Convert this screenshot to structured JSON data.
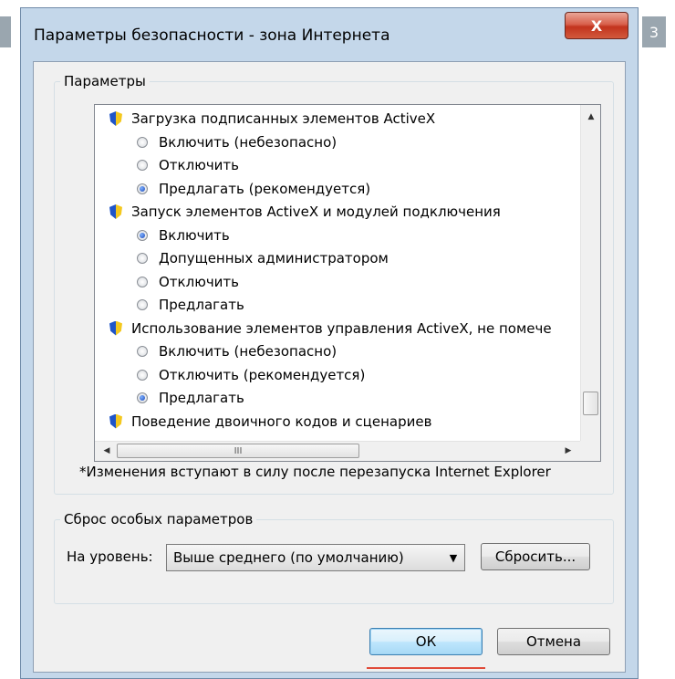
{
  "side_badges": {
    "left": "",
    "right": "3"
  },
  "dialog": {
    "title": "Параметры безопасности - зона Интернета",
    "close_label": "X"
  },
  "params": {
    "legend": "Параметры",
    "items": [
      {
        "kind": "header",
        "label": "Загрузка подписанных элементов ActiveX",
        "icon": "shield-icon"
      },
      {
        "kind": "option",
        "label": "Включить (небезопасно)",
        "checked": false
      },
      {
        "kind": "option",
        "label": "Отключить",
        "checked": false
      },
      {
        "kind": "option",
        "label": "Предлагать (рекомендуется)",
        "checked": true
      },
      {
        "kind": "header",
        "label": "Запуск элементов ActiveX и модулей подключения",
        "icon": "shield-icon"
      },
      {
        "kind": "option",
        "label": "Включить",
        "checked": true
      },
      {
        "kind": "option",
        "label": "Допущенных администратором",
        "checked": false
      },
      {
        "kind": "option",
        "label": "Отключить",
        "checked": false
      },
      {
        "kind": "option",
        "label": "Предлагать",
        "checked": false
      },
      {
        "kind": "header",
        "label": "Использование элементов управления ActiveX, не помече",
        "icon": "shield-icon"
      },
      {
        "kind": "option",
        "label": "Включить (небезопасно)",
        "checked": false
      },
      {
        "kind": "option",
        "label": "Отключить (рекомендуется)",
        "checked": false
      },
      {
        "kind": "option",
        "label": "Предлагать",
        "checked": true
      },
      {
        "kind": "header",
        "label": "Поведение двоичного кодов и сценариев",
        "icon": "shield-icon"
      }
    ],
    "hscroll_grip": "III",
    "note": "*Изменения вступают в силу после перезапуска Internet Explorer"
  },
  "reset": {
    "legend": "Сброс особых параметров",
    "level_label": "На уровень:",
    "level_value": "Выше среднего (по умолчанию)",
    "reset_button": "Сбросить..."
  },
  "buttons": {
    "ok": "ОК",
    "cancel": "Отмена"
  },
  "colors": {
    "focus_underline": "#e04b3a",
    "close_button": "#c2331d"
  }
}
